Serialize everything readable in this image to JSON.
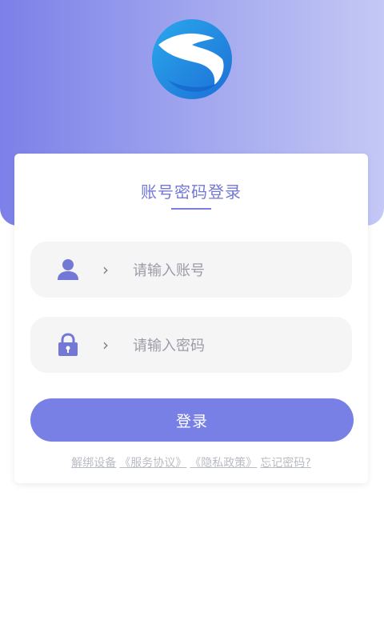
{
  "login": {
    "title": "账号密码登录",
    "account": {
      "placeholder": "请输入账号"
    },
    "password": {
      "placeholder": "请输入密码"
    },
    "submit_label": "登录",
    "links": {
      "unbind": "解绑设备",
      "service": "《服务协议》",
      "privacy": "《隐私政策》",
      "forgot": "忘记密码?"
    }
  },
  "colors": {
    "accent": "#7880e6",
    "header_start": "#7c80e8",
    "header_end": "#c4c8f5"
  }
}
